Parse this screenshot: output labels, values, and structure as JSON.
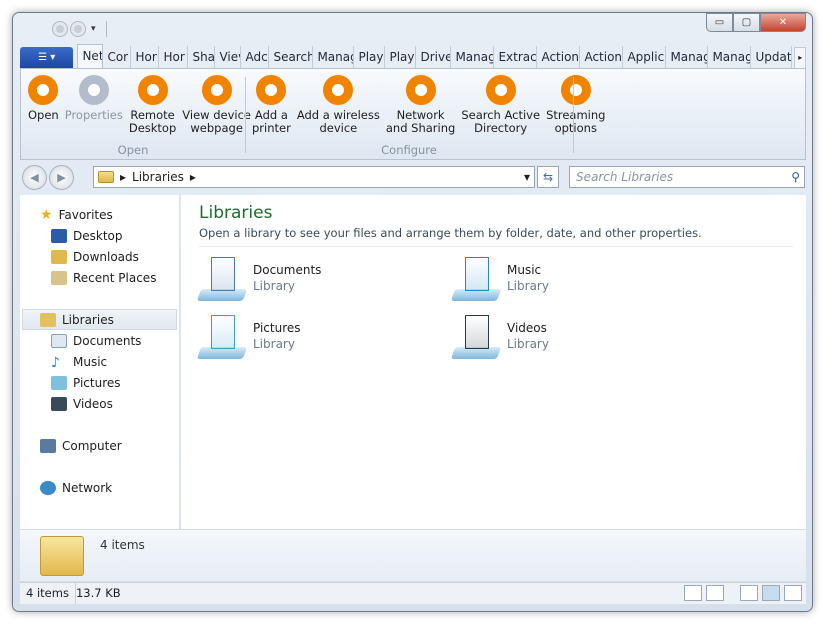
{
  "window": {
    "caption_buttons": {
      "minimize": "▭",
      "maximize": "▢",
      "close": "✕"
    }
  },
  "ribbon": {
    "app_button": "☰ ▾",
    "tabs": [
      "Net",
      "Cor",
      "Hor",
      "Hor",
      "Sha",
      "Viev",
      "Adc",
      "Search",
      "Manag",
      "Play",
      "Play",
      "Drive",
      "Manag",
      "Extract",
      "Action",
      "Action",
      "Applic",
      "Manag",
      "Manag",
      "Updat"
    ],
    "tab_scroll": "▸",
    "groups": [
      {
        "label": "Open",
        "buttons": [
          {
            "label": "Open",
            "enabled": true
          },
          {
            "label": "Properties",
            "enabled": false
          },
          {
            "label": "Remote\nDesktop",
            "enabled": true
          },
          {
            "label": "View device\nwebpage",
            "enabled": true
          }
        ]
      },
      {
        "label": "Configure",
        "buttons": [
          {
            "label": "Add a\nprinter",
            "enabled": true
          },
          {
            "label": "Add a wireless\ndevice",
            "enabled": true
          },
          {
            "label": "Network\nand Sharing",
            "enabled": true
          },
          {
            "label": "Search Active\nDirectory",
            "enabled": true
          },
          {
            "label": "Streaming\noptions",
            "enabled": true
          }
        ]
      }
    ],
    "accent": "#f08300"
  },
  "address": {
    "back": "◀",
    "forward": "▶",
    "path": "Libraries",
    "sep": "▸",
    "dropdown": "▾",
    "refresh": "⇆",
    "search_placeholder": "Search Libraries",
    "search_icon": "⚲"
  },
  "nav": {
    "favorites": "Favorites",
    "fav_items": [
      "Desktop",
      "Downloads",
      "Recent Places"
    ],
    "libraries": "Libraries",
    "lib_items": [
      "Documents",
      "Music",
      "Pictures",
      "Videos"
    ],
    "computer": "Computer",
    "network": "Network"
  },
  "content": {
    "title": "Libraries",
    "subtitle": "Open a library to see your files and arrange them by folder, date, and other properties.",
    "libraries": [
      {
        "name": "Documents",
        "type": "Library",
        "color": "#4a78b0"
      },
      {
        "name": "Music",
        "type": "Library",
        "color": "#1e88d0"
      },
      {
        "name": "Pictures",
        "type": "Library",
        "color": "#3aa0c8"
      },
      {
        "name": "Videos",
        "type": "Library",
        "color": "#2a3a4a"
      }
    ]
  },
  "details": {
    "count": "4 items"
  },
  "status": {
    "items": "4 items",
    "size": "13.7 KB"
  }
}
